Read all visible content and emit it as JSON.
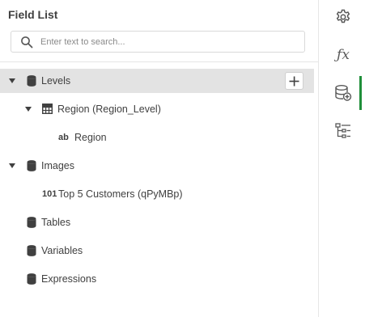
{
  "panel": {
    "title": "Field List"
  },
  "search": {
    "placeholder": "Enter text to search..."
  },
  "tree": {
    "levels": {
      "label": "Levels"
    },
    "region_level": {
      "label": "Region (Region_Level)"
    },
    "region": {
      "tag": "ab",
      "label": "Region"
    },
    "images": {
      "label": "Images"
    },
    "top5": {
      "tag": "101",
      "label": "Top 5 Customers (qPyMBp)"
    },
    "tables": {
      "label": "Tables"
    },
    "variables": {
      "label": "Variables"
    },
    "expressions": {
      "label": "Expressions"
    }
  },
  "sidebar": {
    "items": [
      "gear-icon",
      "fx-icon",
      "database-add-icon",
      "hierarchy-icon"
    ],
    "active": "database-add-icon",
    "accent": "#1f8f3a"
  }
}
